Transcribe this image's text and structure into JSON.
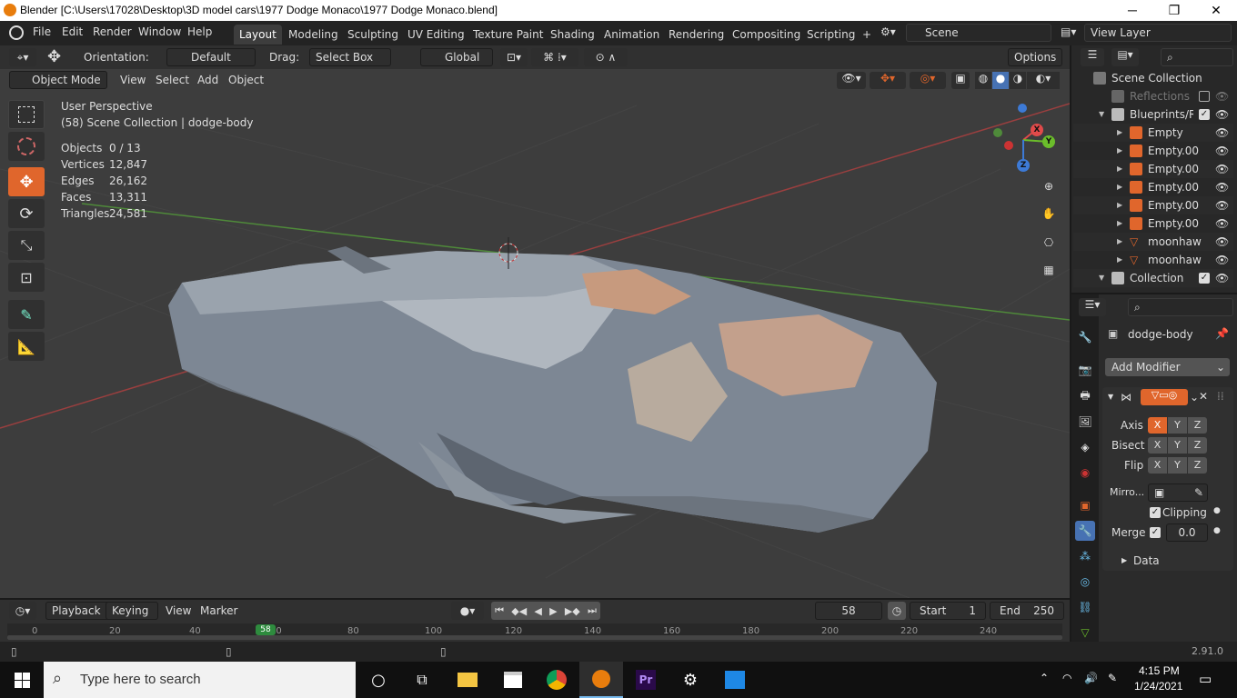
{
  "window": {
    "title": "Blender [C:\\Users\\17028\\Desktop\\3D model cars\\1977 Dodge Monaco\\1977 Dodge Monaco.blend]",
    "min": "─",
    "max": "❐",
    "close": "✕"
  },
  "topbar": {
    "menus": [
      "File",
      "Edit",
      "Render",
      "Window",
      "Help"
    ],
    "workspaces": [
      "Layout",
      "Modeling",
      "Sculpting",
      "UV Editing",
      "Texture Paint",
      "Shading",
      "Animation",
      "Rendering",
      "Compositing",
      "Scripting"
    ],
    "add_workspace": "+",
    "scene": "Scene",
    "view_layer": "View Layer"
  },
  "toolheader": {
    "orientation_label": "Orientation:",
    "orientation_value": "Default",
    "drag_label": "Drag:",
    "drag_value": "Select Box",
    "transform_orientation": "Global",
    "options": "Options"
  },
  "viewport_header": {
    "mode": "Object Mode",
    "menus": [
      "View",
      "Select",
      "Add",
      "Object"
    ]
  },
  "overlay": {
    "perspective": "User Perspective",
    "collection_info": "(58) Scene Collection | dodge-body",
    "stats": [
      {
        "label": "Objects",
        "value": "0 / 13"
      },
      {
        "label": "Vertices",
        "value": "12,847"
      },
      {
        "label": "Edges",
        "value": "26,162"
      },
      {
        "label": "Faces",
        "value": "13,311"
      },
      {
        "label": "Triangles",
        "value": "24,581"
      }
    ]
  },
  "gizmo": {
    "x": "X",
    "y": "Y",
    "z": "Z"
  },
  "outliner": {
    "rows": [
      {
        "label": "Scene Collection",
        "type": "scene"
      },
      {
        "label": "Reflections",
        "type": "collection"
      },
      {
        "label": "Blueprints/Ref",
        "type": "collection"
      },
      {
        "label": "Empty",
        "type": "empty"
      },
      {
        "label": "Empty.00",
        "type": "empty"
      },
      {
        "label": "Empty.00",
        "type": "empty"
      },
      {
        "label": "Empty.00",
        "type": "empty"
      },
      {
        "label": "Empty.00",
        "type": "empty"
      },
      {
        "label": "Empty.00",
        "type": "empty"
      },
      {
        "label": "moonhaw",
        "type": "mesh"
      },
      {
        "label": "moonhaw",
        "type": "mesh"
      },
      {
        "label": "Collection",
        "type": "collection"
      }
    ]
  },
  "properties": {
    "object_name": "dodge-body",
    "add_modifier": "Add Modifier",
    "axis_label": "Axis",
    "bisect_label": "Bisect",
    "flip_label": "Flip",
    "axes": [
      "X",
      "Y",
      "Z"
    ],
    "mirror_label": "Mirro...",
    "clipping_label": "Clipping",
    "merge_label": "Merge",
    "merge_value": "0.0",
    "data_label": "Data"
  },
  "timeline": {
    "menus": [
      "Playback",
      "Keying",
      "View",
      "Marker"
    ],
    "current_frame": "58",
    "start_label": "Start",
    "start_value": "1",
    "end_label": "End",
    "end_value": "250",
    "ticks": [
      "0",
      "20",
      "40",
      "60",
      "80",
      "100",
      "120",
      "140",
      "160",
      "180",
      "200",
      "220",
      "240"
    ],
    "playhead": "58"
  },
  "statusbar": {
    "version": "2.91.0"
  },
  "taskbar": {
    "search_placeholder": "Type here to search",
    "time": "4:15 PM",
    "date": "1/24/2021"
  },
  "colors": {
    "accent": "#e0662c",
    "active_blue": "#4772b3",
    "x_axis": "#e04a4a",
    "y_axis": "#6bbd2b",
    "z_axis": "#3d7ad6"
  }
}
